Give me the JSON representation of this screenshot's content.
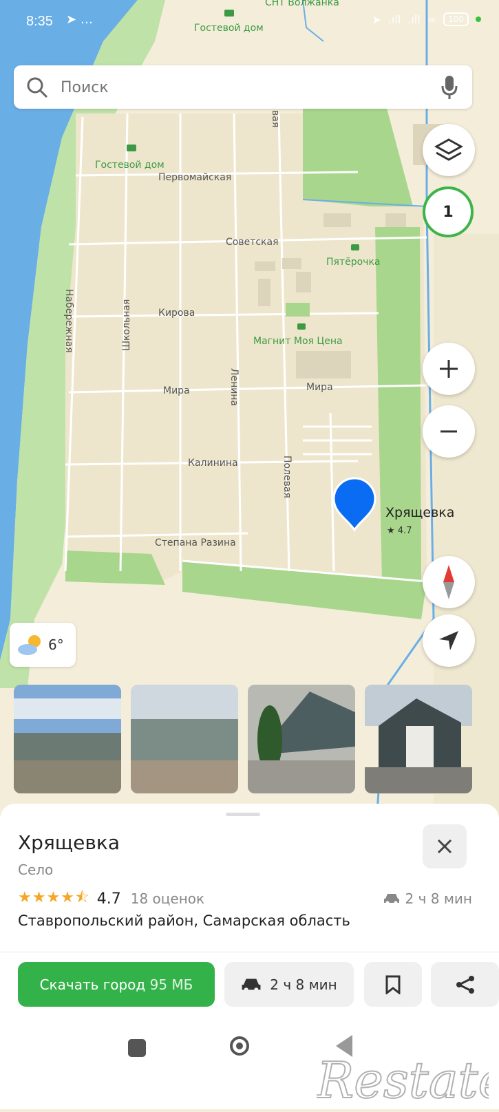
{
  "status_bar": {
    "time": "8:35",
    "extra": "…",
    "battery": "100"
  },
  "search": {
    "placeholder": "Поиск"
  },
  "map": {
    "streets": {
      "pervomayskaya": "Первомайская",
      "sovetskaya": "Советская",
      "kirova": "Кирова",
      "mira_left": "Мира",
      "mira_right": "Мира",
      "kalinina": "Калинина",
      "stepana_razina": "Степана Разина",
      "naberezhnaya": "Набережная",
      "shkolnaya": "Школьная",
      "lenina": "Ленина",
      "polevaya": "Полевая",
      "top_vertical": "вая"
    },
    "pois": {
      "guest_house_top": "Гостевой дом",
      "guest_house": "Гостевой дом",
      "pyaterochka": "Пятёрочка",
      "magnit": "Магнит Моя Цена",
      "snt": "СНТ Волжанка"
    },
    "place": {
      "name": "Хрящевка",
      "rating": "★ 4.7"
    },
    "badge": "1",
    "weather": "6°"
  },
  "sheet": {
    "title": "Хрящевка",
    "subtitle": "Село",
    "stars": "★★★★⯪",
    "rating": "4.7",
    "reviews": "18 оценок",
    "drive_time": "2 ч 8 мин",
    "address": "Ставропольский район, Самарская область",
    "download_label": "Скачать город",
    "download_size": "95 МБ",
    "route_time": "2 ч 8 мин"
  },
  "colors": {
    "accent_green": "#33b249",
    "pin_blue": "#0a6cf2"
  },
  "icons": [
    "search-icon",
    "mic-icon",
    "layers-icon",
    "plus-icon",
    "minus-icon",
    "compass-icon",
    "locate-icon",
    "close-icon",
    "car-icon",
    "bookmark-icon",
    "share-icon"
  ]
}
